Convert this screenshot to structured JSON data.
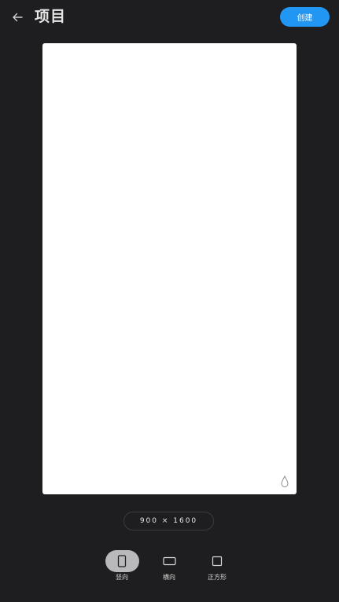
{
  "header": {
    "title": "项目",
    "create_label": "创建"
  },
  "canvas": {
    "size_label": "900 × 1600"
  },
  "orientations": [
    {
      "label": "竖向",
      "icon": "portrait-icon",
      "selected": true
    },
    {
      "label": "横向",
      "icon": "landscape-icon",
      "selected": false
    },
    {
      "label": "正方形",
      "icon": "square-icon",
      "selected": false
    }
  ],
  "colors": {
    "background": "#1e1e20",
    "accent": "#2196f3",
    "selected_pill": "#b9b9bb",
    "canvas": "#ffffff"
  }
}
